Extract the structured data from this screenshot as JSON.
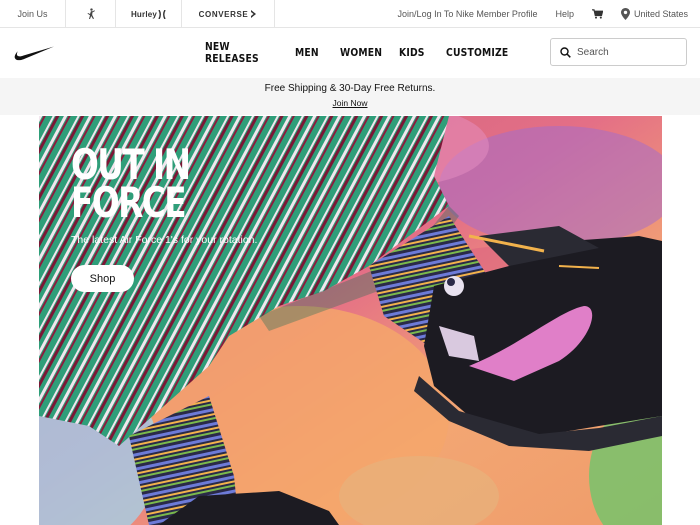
{
  "utility": {
    "join_us": "Join Us",
    "brands": {
      "jordan_icon": "jumpman-icon",
      "hurley": "Hurley",
      "converse": "CONVERSE"
    },
    "member_link": "Join/Log In To Nike Member Profile",
    "help": "Help",
    "cart_icon": "cart-icon",
    "location_icon": "location-pin-icon",
    "country": "United States"
  },
  "nav": {
    "logo_icon": "nike-swoosh-icon",
    "items": [
      "NEW RELEASES",
      "MEN",
      "WOMEN",
      "KIDS",
      "CUSTOMIZE"
    ],
    "search_placeholder": "Search"
  },
  "promo": {
    "message": "Free Shipping & 30-Day Free Returns.",
    "cta": "Join Now"
  },
  "hero": {
    "headline_line1": "OUT IN",
    "headline_line2": "FORCE",
    "subline": "The latest Air Force 1's for your rotation.",
    "button": "Shop"
  },
  "colors": {
    "promo_bg": "#f5f5f5",
    "pant_green": "#2e9e7a",
    "shoe_black": "#1a1a1f",
    "swoosh_pink": "#e07fc8"
  }
}
